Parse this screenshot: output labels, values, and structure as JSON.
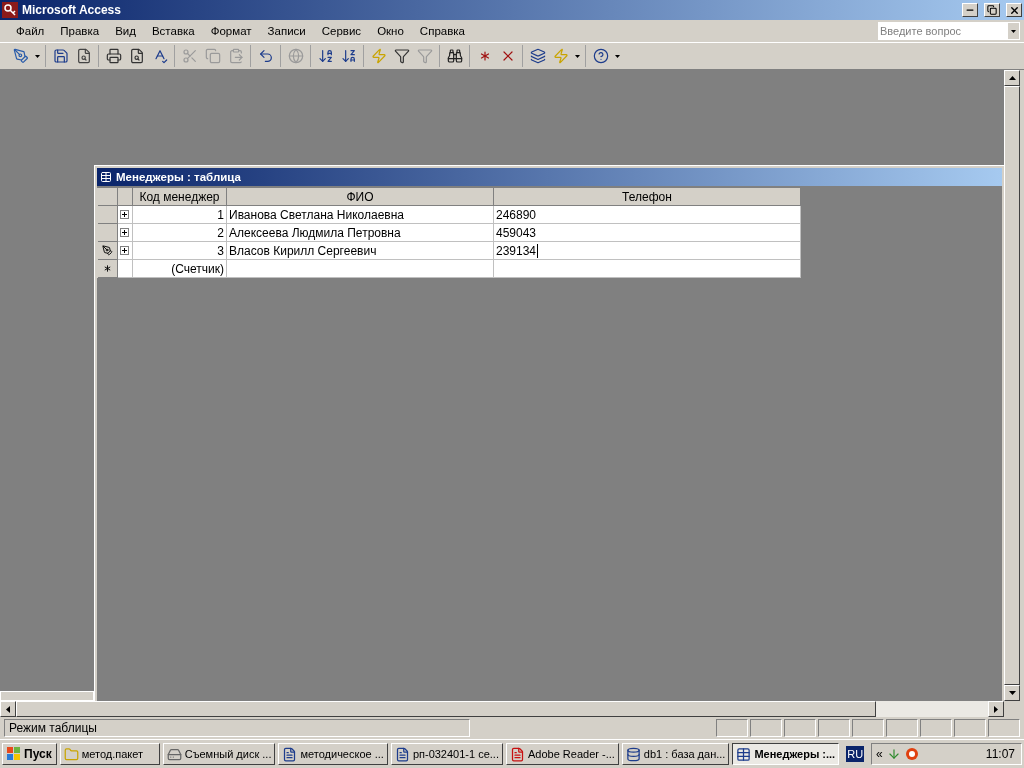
{
  "window": {
    "title": "Microsoft Access"
  },
  "menu": [
    "Файл",
    "Правка",
    "Вид",
    "Вставка",
    "Формат",
    "Записи",
    "Сервис",
    "Окно",
    "Справка"
  ],
  "search": {
    "placeholder": "Введите вопрос"
  },
  "toolbar": {
    "groups": [
      {
        "buttons": [
          {
            "kind": "design",
            "disabled": false
          },
          {
            "kind": "dropdown",
            "disabled": false
          }
        ]
      },
      {
        "buttons": [
          {
            "kind": "save",
            "disabled": false
          },
          {
            "kind": "search",
            "disabled": false
          }
        ]
      },
      {
        "buttons": [
          {
            "kind": "print",
            "disabled": false
          },
          {
            "kind": "preview",
            "disabled": false
          },
          {
            "kind": "spell",
            "disabled": false
          }
        ]
      },
      {
        "buttons": [
          {
            "kind": "cut",
            "disabled": true
          },
          {
            "kind": "copy",
            "disabled": true
          },
          {
            "kind": "paste",
            "disabled": true
          }
        ]
      },
      {
        "buttons": [
          {
            "kind": "undo",
            "disabled": false
          }
        ]
      },
      {
        "buttons": [
          {
            "kind": "link",
            "disabled": true
          }
        ]
      },
      {
        "buttons": [
          {
            "kind": "sort-asc",
            "disabled": false
          },
          {
            "kind": "sort-desc",
            "disabled": false
          }
        ]
      },
      {
        "buttons": [
          {
            "kind": "filter-selection",
            "disabled": false
          },
          {
            "kind": "filter-form",
            "disabled": false
          },
          {
            "kind": "filter",
            "disabled": true
          }
        ]
      },
      {
        "buttons": [
          {
            "kind": "find",
            "disabled": false
          }
        ]
      },
      {
        "buttons": [
          {
            "kind": "new-record",
            "disabled": false
          },
          {
            "kind": "delete-record",
            "disabled": false
          }
        ]
      },
      {
        "buttons": [
          {
            "kind": "database",
            "disabled": false
          },
          {
            "kind": "new-object",
            "disabled": false
          },
          {
            "kind": "dropdown",
            "disabled": false
          }
        ]
      },
      {
        "buttons": [
          {
            "kind": "help",
            "disabled": false
          },
          {
            "kind": "dropdown",
            "disabled": false
          }
        ]
      }
    ]
  },
  "document": {
    "title": "Менеджеры : таблица",
    "table": {
      "columns": [
        "Код менеджер",
        "ФИО",
        "Телефон"
      ],
      "rows": [
        {
          "kind": "record",
          "editing": false,
          "cells": [
            "1",
            "Иванова Светлана Николаевна",
            "246890"
          ]
        },
        {
          "kind": "record",
          "editing": false,
          "cells": [
            "2",
            "Алексеева Людмила Петровна",
            "459043"
          ]
        },
        {
          "kind": "record",
          "editing": true,
          "cells": [
            "3",
            "Власов Кирилл Сергеевич",
            "239134"
          ]
        },
        {
          "kind": "new",
          "editing": false,
          "cells": [
            "(Счетчик)",
            "",
            ""
          ]
        }
      ]
    }
  },
  "status_bar": "Режим таблицы",
  "taskbar": {
    "start": "Пуск",
    "tasks": [
      {
        "kind": "folder",
        "label": "метод.пакет",
        "selected": false
      },
      {
        "kind": "drive",
        "label": "Съемный диск ...",
        "selected": false
      },
      {
        "kind": "word",
        "label": "методическое ...",
        "selected": false
      },
      {
        "kind": "word",
        "label": "рп-032401-1 се...",
        "selected": false
      },
      {
        "kind": "pdf",
        "label": "Adobe Reader -...",
        "selected": false
      },
      {
        "kind": "database",
        "label": "db1 : база дан...",
        "selected": false
      },
      {
        "kind": "table",
        "label": "Менеджеры :...",
        "selected": true
      }
    ],
    "language": "RU",
    "tray_toggle": "«",
    "time": "11:07"
  }
}
